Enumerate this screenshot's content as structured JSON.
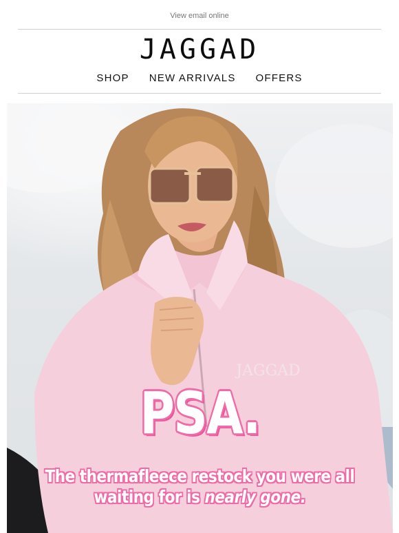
{
  "header": {
    "view_online": "View email online",
    "logo": "JAGGAD"
  },
  "nav": {
    "items": [
      "SHOP",
      "NEW ARRIVALS",
      "OFFERS"
    ]
  },
  "hero": {
    "headline": "PSA.",
    "tagline_line1": "The thermafleece restock you were all",
    "tagline_line2_prefix": "waiting for is ",
    "tagline_line2_emphasis": "nearly gone.",
    "garment_print": "JAGGAD"
  },
  "colors": {
    "accent_pink": "#f06aa8",
    "fleece_pink": "#f6cfdc",
    "text": "#111111"
  }
}
